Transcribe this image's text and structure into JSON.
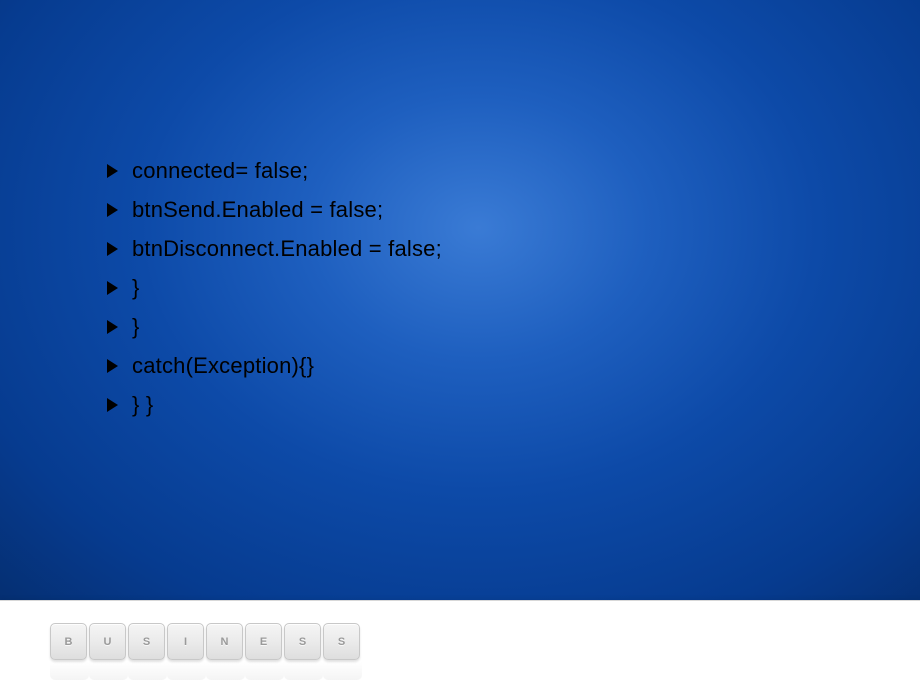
{
  "bullets": [
    "connected= false;",
    "btnSend.Enabled  = false;",
    "btnDisconnect.Enabled  = false;",
    "}",
    "}",
    "catch(Exception){}",
    "} }"
  ],
  "footer_keys": [
    "B",
    "U",
    "S",
    "I",
    "N",
    "E",
    "S",
    "S"
  ]
}
